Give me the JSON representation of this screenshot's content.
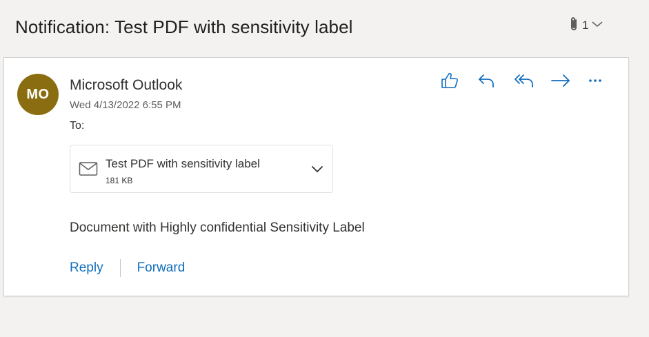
{
  "message": {
    "subject": "Notification: Test PDF with sensitivity label",
    "attachment_count": "1"
  },
  "sender": {
    "initials": "MO",
    "name": "Microsoft Outlook",
    "date": "Wed 4/13/2022 6:55 PM",
    "avatar_color": "#8a6d10"
  },
  "recipients": {
    "label": "To:",
    "value": ""
  },
  "toolbar": {
    "icons": [
      "like-icon",
      "reply-icon",
      "reply-all-icon",
      "forward-icon",
      "more-icon"
    ],
    "accent_color": "#0f6cbd"
  },
  "attachment": {
    "name": "Test PDF with sensitivity label",
    "size": "181 KB",
    "icon": "mail-icon"
  },
  "body": {
    "text": "Document with Highly confidential Sensitivity Label"
  },
  "quick_actions": {
    "reply_label": "Reply",
    "forward_label": "Forward"
  }
}
